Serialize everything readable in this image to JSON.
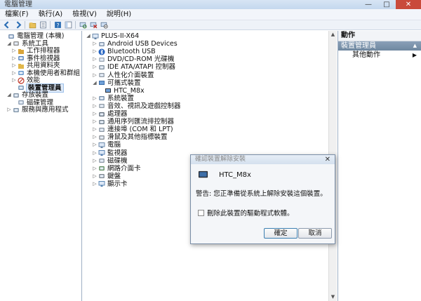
{
  "window": {
    "title": "電腦管理",
    "controls": [
      "—",
      "□",
      "✕"
    ]
  },
  "menubar": {
    "items": [
      "檔案(F)",
      "執行(A)",
      "檢視(V)",
      "說明(H)"
    ]
  },
  "colors": {
    "selection": "#dde8f6",
    "accent": "#3c7fb1",
    "close": "#c94a3b"
  },
  "left_tree": [
    {
      "label": "電腦管理 (本機)",
      "icon": "computer-management-icon",
      "twisty": "",
      "level": 0
    },
    {
      "label": "系統工具",
      "icon": "system-tools-icon",
      "twisty": "◢",
      "level": 1
    },
    {
      "label": "工作排程器",
      "icon": "task-scheduler-icon",
      "twisty": "▷",
      "level": 2
    },
    {
      "label": "事件檢視器",
      "icon": "event-viewer-icon",
      "twisty": "▷",
      "level": 2
    },
    {
      "label": "共用資料夾",
      "icon": "shared-folders-icon",
      "twisty": "▷",
      "level": 2
    },
    {
      "label": "本機使用者和群組",
      "icon": "users-groups-icon",
      "twisty": "▷",
      "level": 2
    },
    {
      "label": "效能",
      "icon": "performance-icon",
      "twisty": "▷",
      "level": 2
    },
    {
      "label": "裝置管理員",
      "icon": "device-manager-icon",
      "twisty": "",
      "level": 2,
      "selected": true
    },
    {
      "label": "存放裝置",
      "icon": "storage-icon",
      "twisty": "◢",
      "level": 1
    },
    {
      "label": "磁碟管理",
      "icon": "disk-management-icon",
      "twisty": "",
      "level": 2
    },
    {
      "label": "服務與應用程式",
      "icon": "services-apps-icon",
      "twisty": "▷",
      "level": 1
    }
  ],
  "device_tree": [
    {
      "label": "PLUS-II-X64",
      "icon": "computer-icon",
      "twisty": "◢",
      "level": 0
    },
    {
      "label": "Android USB Devices",
      "icon": "android-usb-icon",
      "twisty": "▷",
      "level": 1
    },
    {
      "label": "Bluetooth USB",
      "icon": "bluetooth-icon",
      "twisty": "▷",
      "level": 1
    },
    {
      "label": "DVD/CD-ROM 光碟機",
      "icon": "dvd-drive-icon",
      "twisty": "▷",
      "level": 1
    },
    {
      "label": "IDE ATA/ATAPI 控制器",
      "icon": "ide-controller-icon",
      "twisty": "▷",
      "level": 1
    },
    {
      "label": "人性化介面裝置",
      "icon": "hid-icon",
      "twisty": "▷",
      "level": 1
    },
    {
      "label": "可攜式裝置",
      "icon": "portable-device-icon",
      "twisty": "◢",
      "level": 1
    },
    {
      "label": "HTC_M8x",
      "icon": "phone-icon",
      "twisty": "",
      "level": 2
    },
    {
      "label": "系統裝置",
      "icon": "system-device-icon",
      "twisty": "▷",
      "level": 1
    },
    {
      "label": "音效、視訊及遊戲控制器",
      "icon": "sound-icon",
      "twisty": "▷",
      "level": 1
    },
    {
      "label": "處理器",
      "icon": "processor-icon",
      "twisty": "▷",
      "level": 1
    },
    {
      "label": "通用序列匯流排控制器",
      "icon": "usb-controller-icon",
      "twisty": "▷",
      "level": 1
    },
    {
      "label": "連接埠 (COM 和 LPT)",
      "icon": "port-icon",
      "twisty": "▷",
      "level": 1
    },
    {
      "label": "滑鼠及其他指標裝置",
      "icon": "mouse-icon",
      "twisty": "▷",
      "level": 1
    },
    {
      "label": "電腦",
      "icon": "computer-icon",
      "twisty": "▷",
      "level": 1
    },
    {
      "label": "監視器",
      "icon": "monitor-icon",
      "twisty": "▷",
      "level": 1
    },
    {
      "label": "磁碟機",
      "icon": "disk-drive-icon",
      "twisty": "▷",
      "level": 1
    },
    {
      "label": "網路介面卡",
      "icon": "network-adapter-icon",
      "twisty": "▷",
      "level": 1
    },
    {
      "label": "鍵盤",
      "icon": "keyboard-icon",
      "twisty": "▷",
      "level": 1
    },
    {
      "label": "顯示卡",
      "icon": "display-adapter-icon",
      "twisty": "▷",
      "level": 1
    }
  ],
  "actions": {
    "header": "動作",
    "section": "裝置管理員",
    "item": "其他動作",
    "arrow": "▲",
    "item_arrow": "▶"
  },
  "dialog": {
    "title": "確認裝置解除安裝",
    "close": "✕",
    "device_name": "HTC_M8x",
    "warning": "警告: 您正準備從系統上解除安裝這個裝置。",
    "checkbox_label": "刪除此裝置的驅動程式軟體。",
    "checkbox_checked": false,
    "ok": "確定",
    "cancel": "取消"
  },
  "scrollbar": {
    "up": "▲",
    "down": "▼"
  }
}
